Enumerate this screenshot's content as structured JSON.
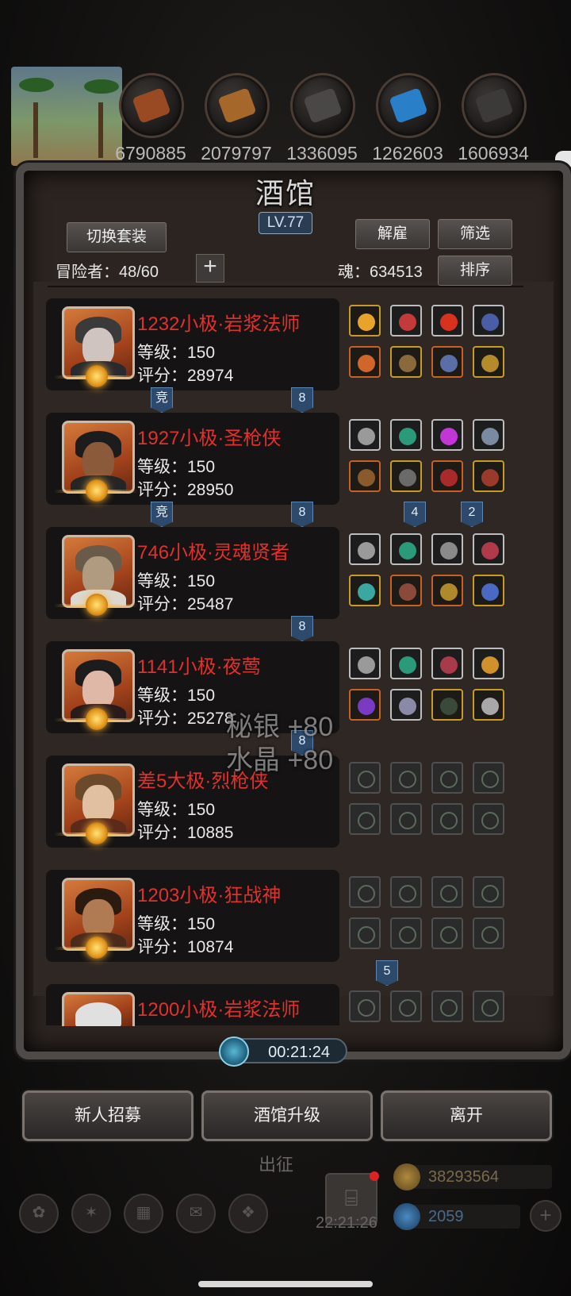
{
  "resources": [
    "6790885",
    "2079797",
    "1336095",
    "1262603",
    "1606934"
  ],
  "panel": {
    "title": "酒馆",
    "level": "LV.77",
    "switch_suit_label": "切换套装",
    "dismiss_label": "解雇",
    "filter_label": "筛选",
    "sort_label": "排序",
    "adventurer_count": "冒险者：48/60",
    "soul": "魂：634513"
  },
  "adventurers": [
    {
      "name": "1232小极·岩浆法师",
      "level": "等级：150",
      "score": "评分：28974"
    },
    {
      "name": "1927小极·圣枪侠",
      "level": "等级：150",
      "score": "评分：28950"
    },
    {
      "name": "746小极·灵魂贤者",
      "level": "等级：150",
      "score": "评分：25487"
    },
    {
      "name": "1141小极·夜莺",
      "level": "等级：150",
      "score": "评分：25278"
    },
    {
      "name": "差5大极·烈枪侠",
      "level": "等级：150",
      "score": "评分：10885"
    },
    {
      "name": "1203小极·狂战神",
      "level": "等级：150",
      "score": "评分：10874"
    },
    {
      "name": "1200小极·岩浆法师"
    }
  ],
  "tags": {
    "r1_a": "竞",
    "r1_b": "8",
    "r2_a": "竞",
    "r2_b": "8",
    "r2_c": "4",
    "r2_d": "2",
    "r3_b": "8",
    "r4_b": "8",
    "r6_c": "5"
  },
  "floating": {
    "line1": "秘银 +80",
    "line2": "水晶 +80"
  },
  "timer": "00:21:24",
  "buttons": {
    "recruit": "新人招募",
    "upgrade": "酒馆升级",
    "leave": "离开"
  },
  "bottom": {
    "dispatch": "出征",
    "gift_timer": "22:21:26",
    "gold": "38293564",
    "gems": "2059"
  }
}
